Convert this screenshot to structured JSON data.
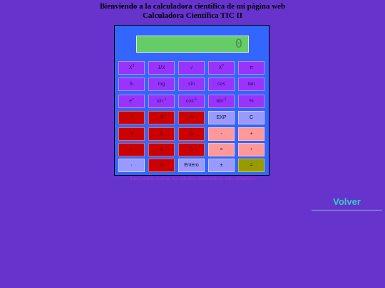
{
  "heading": {
    "line1": "Bienviendo a la calculadora científica de mi página web",
    "line2": "Calculadora Científica TIC II"
  },
  "display": {
    "value": "0"
  },
  "buttons": {
    "row1": [
      {
        "label": "X",
        "sup": "2",
        "style": "fn"
      },
      {
        "label": "1/X",
        "sup": "",
        "style": "fn"
      },
      {
        "label": "√",
        "sup": "",
        "style": "fn"
      },
      {
        "label": "X",
        "sup": "Y",
        "style": "fn"
      },
      {
        "label": "π",
        "sup": "",
        "style": "fn"
      }
    ],
    "row2": [
      {
        "label": "ln",
        "sup": "",
        "style": "fn"
      },
      {
        "label": "log",
        "sup": "",
        "style": "fn"
      },
      {
        "label": "sin",
        "sup": "",
        "style": "fn"
      },
      {
        "label": "cos",
        "sup": "",
        "style": "fn"
      },
      {
        "label": "tan",
        "sup": "",
        "style": "fn"
      }
    ],
    "row3": [
      {
        "label": "e",
        "sup": "x",
        "style": "fn"
      },
      {
        "label": "sin",
        "sup": "-1",
        "style": "fn"
      },
      {
        "label": "cos",
        "sup": "-1",
        "style": "fn"
      },
      {
        "label": "tan",
        "sup": "-1",
        "style": "fn"
      },
      {
        "label": "%",
        "sup": "",
        "style": "fn"
      }
    ],
    "row4": [
      {
        "label": "7",
        "sup": "",
        "style": "num"
      },
      {
        "label": "8",
        "sup": "",
        "style": "num"
      },
      {
        "label": "9",
        "sup": "",
        "style": "num"
      },
      {
        "label": "EXP",
        "sup": "",
        "style": "light"
      },
      {
        "label": "C",
        "sup": "",
        "style": "light"
      }
    ],
    "row5": [
      {
        "label": "4",
        "sup": "",
        "style": "num"
      },
      {
        "label": "5",
        "sup": "",
        "style": "num"
      },
      {
        "label": "6",
        "sup": "",
        "style": "num"
      },
      {
        "label": "-",
        "sup": "",
        "style": "op"
      },
      {
        "label": "+",
        "sup": "",
        "style": "op"
      }
    ],
    "row6": [
      {
        "label": "1",
        "sup": "",
        "style": "num"
      },
      {
        "label": "2",
        "sup": "",
        "style": "num"
      },
      {
        "label": "3",
        "sup": "",
        "style": "num"
      },
      {
        "label": "×",
        "sup": "",
        "style": "op"
      },
      {
        "label": "÷",
        "sup": "",
        "style": "op"
      }
    ],
    "row7": [
      {
        "label": "·",
        "sup": "",
        "style": "light"
      },
      {
        "label": "0",
        "sup": "",
        "style": "num"
      },
      {
        "label": "Entero",
        "sup": "",
        "style": "light"
      },
      {
        "label": "±",
        "sup": "",
        "style": "light"
      },
      {
        "label": "=",
        "sup": "",
        "style": "eq"
      }
    ]
  },
  "note": "Aquí podrás realizar los cálculos matemáticos más complejos",
  "volver": "Volver",
  "colors": {
    "background": "#6633cc",
    "calculator": "#3366ff",
    "display": "#66cc66",
    "function_key": "#9933ff",
    "digit_key": "#cc0000",
    "operator_key": "#ff9999",
    "equals_key": "#999900",
    "link": "#33cccc"
  }
}
